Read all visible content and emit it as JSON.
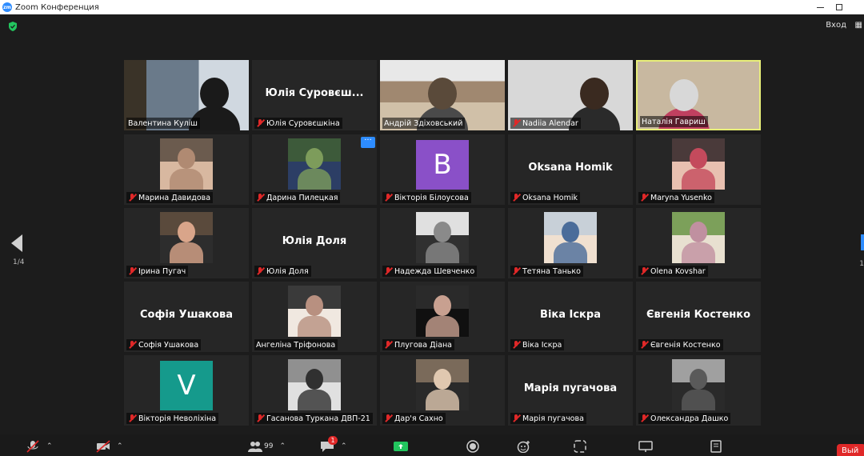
{
  "window": {
    "title": "Zoom Конференция",
    "logo_text": "zm"
  },
  "meeting": {
    "view_label": "Вход",
    "page_indicator": "1/4",
    "page_indicator_right": "1"
  },
  "tiles": [
    {
      "name": "Валентина Куліш",
      "muted": false,
      "kind": "video"
    },
    {
      "name": "Юлія  Суровєшкіна",
      "big": "Юлія  Суровєш...",
      "muted": true,
      "kind": "name"
    },
    {
      "name": "Андрій Здіховський",
      "muted": false,
      "kind": "video"
    },
    {
      "name": "Nadiia Alendar",
      "muted": true,
      "kind": "video"
    },
    {
      "name": "Наталія Гавриш",
      "muted": false,
      "kind": "video",
      "active": true
    },
    {
      "name": "Марина Давидова",
      "muted": true,
      "kind": "thumb"
    },
    {
      "name": "Дарина Пилецкая",
      "muted": true,
      "kind": "thumb",
      "more": "···"
    },
    {
      "name": "Вікторія Білоусова",
      "muted": true,
      "kind": "letter",
      "letter": "B",
      "color": "#8a50c8"
    },
    {
      "name": "Oksana Homik",
      "big": "Oksana Homik",
      "muted": true,
      "kind": "name"
    },
    {
      "name": "Maryna Yusenko",
      "muted": true,
      "kind": "thumb"
    },
    {
      "name": "Ірина Пугач",
      "muted": true,
      "kind": "thumb"
    },
    {
      "name": "Юлія Доля",
      "big": "Юлія Доля",
      "muted": true,
      "kind": "name"
    },
    {
      "name": "Надежда Шевченко",
      "muted": true,
      "kind": "thumb"
    },
    {
      "name": "Тетяна Танько",
      "muted": true,
      "kind": "thumb"
    },
    {
      "name": "Olena Kovshar",
      "muted": true,
      "kind": "thumb"
    },
    {
      "name": "Софія Ушакова",
      "big": "Софія Ушакова",
      "muted": true,
      "kind": "name"
    },
    {
      "name": "Ангеліна Тріфонова",
      "muted": false,
      "kind": "thumb"
    },
    {
      "name": "Плугова Діана",
      "muted": true,
      "kind": "thumb"
    },
    {
      "name": "Віка Іскра",
      "big": "Віка Іскра",
      "muted": true,
      "kind": "name"
    },
    {
      "name": "Євгенія Костенко",
      "big": "Євгенія  Костенко",
      "muted": true,
      "kind": "name"
    },
    {
      "name": "Вікторія Неволіхіна",
      "muted": true,
      "kind": "letter",
      "letter": "V",
      "color": "#159a8c"
    },
    {
      "name": "Гасанова Туркана ДВП-21",
      "muted": true,
      "kind": "thumb"
    },
    {
      "name": "Дар'я Сахно",
      "muted": true,
      "kind": "thumb"
    },
    {
      "name": "Марія пугачова",
      "big": "Марія пугачова",
      "muted": true,
      "kind": "name"
    },
    {
      "name": "Олександра Дашко",
      "muted": true,
      "kind": "thumb"
    }
  ],
  "toolbar": {
    "participants_count": "99",
    "chat_badge": "1",
    "leave_label": "Вый"
  },
  "colors": {
    "accent": "#2d8cff",
    "active_speaker": "#e8ef7a",
    "muted": "#e02828",
    "share": "#22c55e"
  }
}
